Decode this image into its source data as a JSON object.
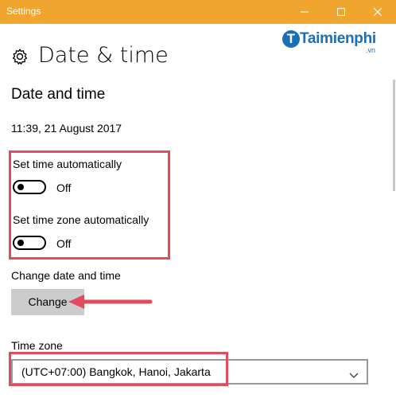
{
  "window": {
    "title": "Settings",
    "accent_color": "#f0a52e"
  },
  "header": {
    "icon": "gear-icon",
    "title": "Date & time"
  },
  "watermark": {
    "name": "Taimienphi",
    "suffix": ".vn",
    "color": "#1a6fb5"
  },
  "section": {
    "title": "Date and time",
    "current_datetime": "11:39, 21 August 2017"
  },
  "settings": {
    "auto_time": {
      "label": "Set time automatically",
      "state": "Off"
    },
    "auto_timezone": {
      "label": "Set time zone automatically",
      "state": "Off"
    }
  },
  "change": {
    "label": "Change date and time",
    "button": "Change"
  },
  "timezone": {
    "label": "Time zone",
    "value": "(UTC+07:00) Bangkok, Hanoi, Jakarta"
  },
  "highlight_color": "#e24b5d"
}
